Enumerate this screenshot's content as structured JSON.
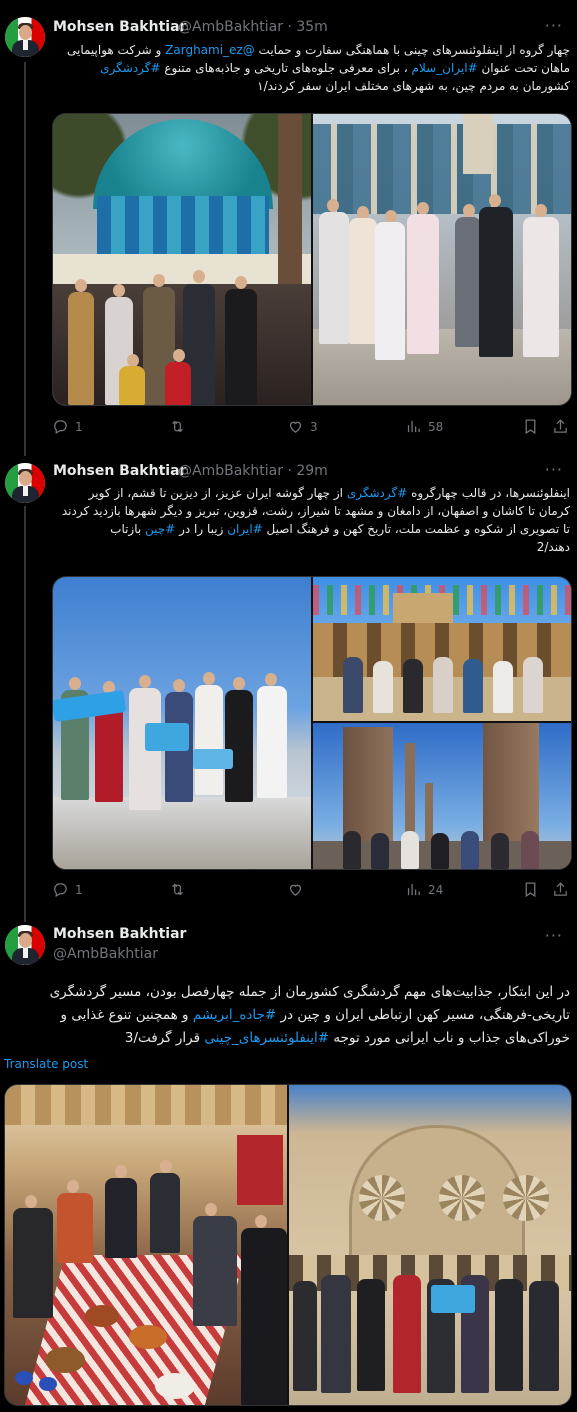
{
  "tweets": [
    {
      "author": "Mohsen Bakhtiar",
      "handle": "@AmbBakhtiar · 35m",
      "more": "···",
      "text_parts": {
        "line1a": "چهار گروه از اینفلوئنسرهای چینی با هماهنگی سفارت و حمایت ",
        "mention": "@Zarghami_ez",
        "line1b": " و شرکت هواپیمایی",
        "line2a": "ماهان تحت عنوان ",
        "hashtag1": "#ایران_سلام",
        "line2b": " ، برای معرفی جلوه‌های تاریخی و جاذبه‌های متنوع ",
        "hashtag2": "#گردشگری",
        "line3": "کشورمان به مردم چین، به شهرهای مختلف  ایران سفر کردند/۱"
      },
      "stats": {
        "replies": "1",
        "retweets": "",
        "likes": "3",
        "views": "58"
      }
    },
    {
      "author": "Mohsen Bakhtiar",
      "handle": "@AmbBakhtiar · 29m",
      "more": "···",
      "text_parts": {
        "line1a": "اینفلوئنسرها، در قالب چهارگروه ",
        "hashtag1": "#گردشگری",
        "line1b": " از چهار گوشه ایران عزیز، از دیزین تا قشم، از کویر",
        "line2": "کرمان تا کاشان و اصفهان، از دامغان و مشهد تا شیراز، رشت، قزوین، تبریز و دیگر شهرها بازدید کردند",
        "line3a": "تا تصویری از شکوه و عظمت ملت، تاریخ کهن و فرهنگ اصیل ",
        "hashtag2": "#ایران",
        "line3b": " زیبا را در ",
        "hashtag3": "#چین",
        "line3c": " بازتاب",
        "line4": "دهند/2"
      },
      "stats": {
        "replies": "1",
        "retweets": "",
        "likes": "",
        "views": "24"
      }
    },
    {
      "author": "Mohsen Bakhtiar",
      "handle": "@AmbBakhtiar",
      "more": "···",
      "text_parts": {
        "line1": "در این ابتکار، جذابیت‌های مهم گردشگری کشورمان از جمله چهارفصل بودن، مسیر گردشگری",
        "line2a": "تاریخی-فرهنگی، مسیر کهن ارتباطی ایران و چین در ",
        "hashtag1": "#جاده_ابریشم",
        "line2b": " و همچنین تنوع غذایی و",
        "line3a": "خوراکی‌های جذاب و ناب ایرانی مورد توجه ",
        "hashtag2": "#اینفلوئنسرهای_چینی",
        "line3b": "  قرار گرفت/3"
      },
      "translate": "Translate post"
    }
  ],
  "colors": {
    "link": "#1d9bf0",
    "muted": "#71767b",
    "background": "#000000",
    "text": "#e7e9ea"
  },
  "icons": [
    "reply-icon",
    "retweet-icon",
    "like-icon",
    "views-icon",
    "bookmark-icon",
    "share-icon"
  ]
}
